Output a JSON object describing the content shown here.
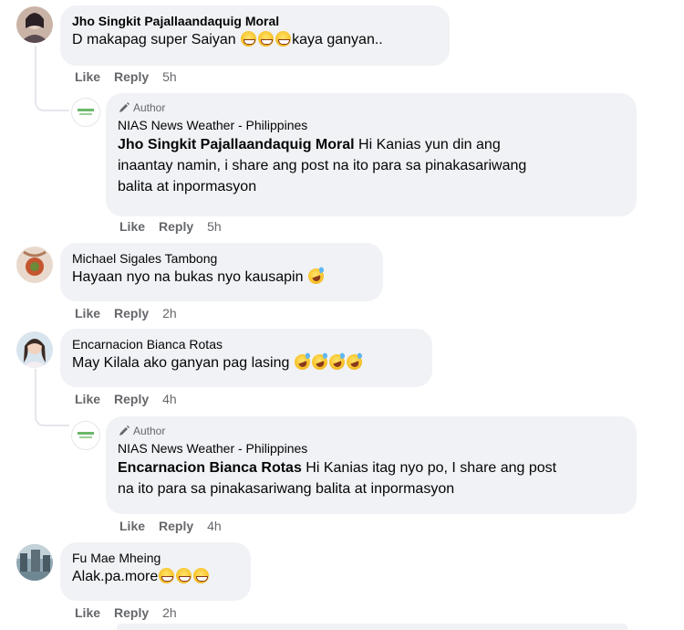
{
  "comments": [
    {
      "name": "Jho Singkit Pajallaandaquig Moral",
      "text": "D makapag super Saiyan ",
      "text_after": "kaya ganyan..",
      "actions": {
        "like": "Like",
        "reply": "Reply",
        "time": "5h"
      }
    },
    {
      "author_badge": "Author",
      "name": "NIAS News Weather - Philippines",
      "mention": "Jho Singkit Pajallaandaquig Moral",
      "text_line1": " Hi Kanias yun din ang",
      "text_line2": "inaantay namin, i share ang post na ito para sa pinakasariwang",
      "text_line3": "balita at inpormasyon",
      "actions": {
        "like": "Like",
        "reply": "Reply",
        "time": "5h"
      }
    },
    {
      "name": "Michael Sigales Tambong",
      "text": "Hayaan nyo na bukas nyo kausapin ",
      "actions": {
        "like": "Like",
        "reply": "Reply",
        "time": "2h"
      }
    },
    {
      "name": "Encarnacion Bianca Rotas",
      "text": "May Kilala ako ganyan pag lasing ",
      "actions": {
        "like": "Like",
        "reply": "Reply",
        "time": "4h"
      }
    },
    {
      "author_badge": "Author",
      "name": "NIAS News Weather - Philippines",
      "mention": "Encarnacion Bianca Rotas",
      "text_line1": " Hi Kanias itag nyo po, I share ang post",
      "text_line2": "na ito para sa pinakasariwang balita at inpormasyon",
      "actions": {
        "like": "Like",
        "reply": "Reply",
        "time": "4h"
      }
    },
    {
      "name": "Fu Mae Mheing",
      "text": "Alak.pa.more",
      "actions": {
        "like": "Like",
        "reply": "Reply",
        "time": "2h"
      }
    }
  ],
  "icons": {
    "author_badge": "pencil-icon",
    "emoji_grin": "grinning-emoji-icon",
    "emoji_laugh": "rolling-laughing-emoji-icon"
  }
}
